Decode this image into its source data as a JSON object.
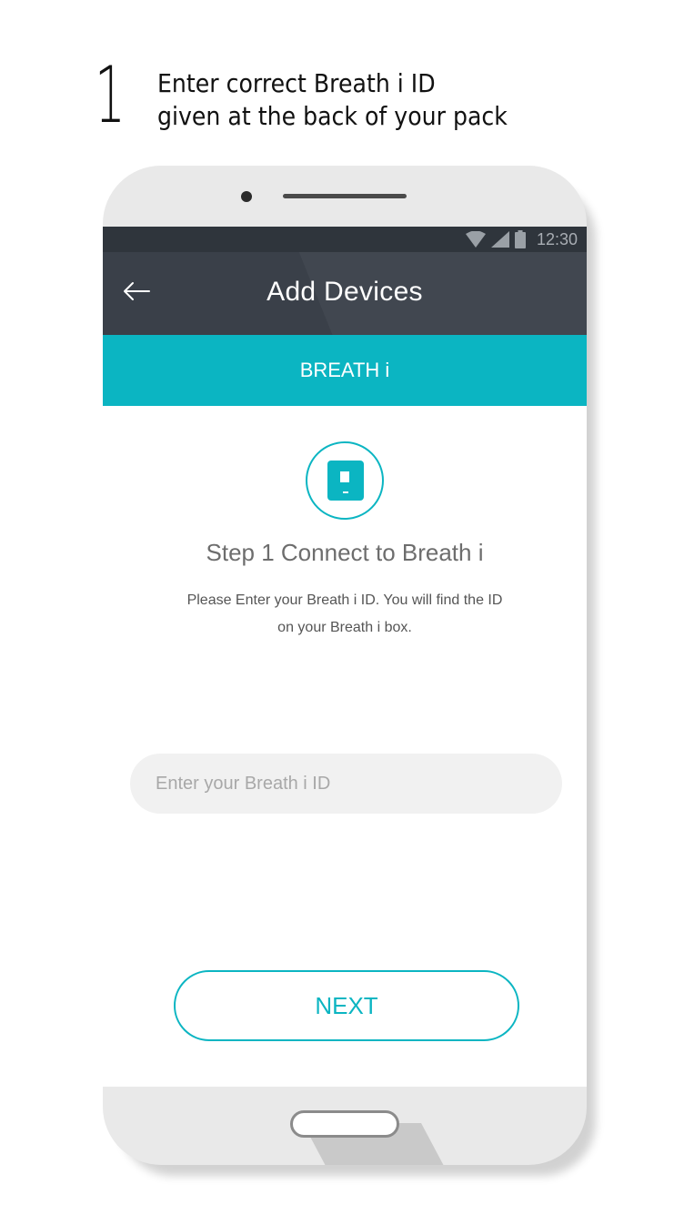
{
  "instruction": {
    "number": "1",
    "line1": "Enter correct Breath i ID",
    "line2": "given at the back of your pack"
  },
  "status_bar": {
    "time": "12:30",
    "icons": [
      "wifi-icon",
      "signal-icon",
      "battery-icon"
    ]
  },
  "app_bar": {
    "title": "Add Devices",
    "back_icon": "back-arrow-icon"
  },
  "tab": {
    "label": "BREATH i"
  },
  "step": {
    "icon": "device-icon",
    "title": "Step 1 Connect to Breath i",
    "description": "Please Enter your Breath i ID. You will find the ID on your Breath i box."
  },
  "id_input": {
    "placeholder": "Enter your Breath i ID",
    "value": ""
  },
  "next_button": {
    "label": "NEXT"
  },
  "colors": {
    "accent": "#0bb5c2",
    "appbar": "#3a4049",
    "statusbar": "#2f353c"
  }
}
